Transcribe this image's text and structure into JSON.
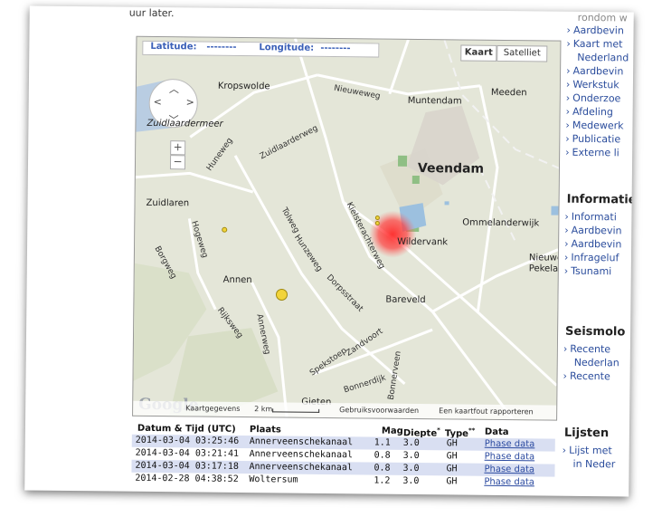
{
  "intro_text": "uur later.",
  "map": {
    "coords": {
      "latitude_label": "Latitude:",
      "latitude_value": "--------",
      "longitude_label": "Longitude:",
      "longitude_value": "--------"
    },
    "map_type_buttons": [
      "Kaart",
      "Satelliet"
    ],
    "zoom_in": "+",
    "zoom_out": "−",
    "places": [
      "Kropswolde",
      "Zuidlaardermeer",
      "Muntendam",
      "Meeden",
      "Veendam",
      "Zuidlaren",
      "Ommelanderwijk",
      "Wildervank",
      "Nieuwe",
      "Pekela",
      "Annen",
      "Bareveld",
      "Gieten"
    ],
    "roads": [
      "Nieuweweg",
      "Zuidlaarderweg",
      "Huneweg",
      "Tolweg",
      "Hunzeweg",
      "Kielsterachterweg",
      "Hogeweg",
      "Borgweg",
      "Dorpsstraat",
      "Rijksweg",
      "Annerweg",
      "Spekstoep",
      "Zandvoort",
      "Bonnerdijk",
      "Bonnerveen"
    ],
    "footer": {
      "logo": "Google",
      "data_link": "Kaartgegevens",
      "scale": "2 km",
      "terms": "Gebruiksvoorwaarden",
      "report": "Een kaartfout rapporteren"
    },
    "markers_color_yellow": "#f2d43a",
    "heat_color": "#ff2a2a"
  },
  "table": {
    "headers": {
      "datetime": "Datum & Tijd (UTC)",
      "place": "Plaats",
      "mag": "Mag",
      "depth": "Diepte",
      "depth_sup": "*",
      "type": "Type",
      "type_sup": "**",
      "data": "Data"
    },
    "rows": [
      {
        "datetime": "2014-03-04 03:25:46",
        "place": "Annerveenschekanaal",
        "mag": "1.1",
        "depth": "3.0",
        "type": "GH",
        "data": "Phase data"
      },
      {
        "datetime": "2014-03-04 03:21:41",
        "place": "Annerveenschekanaal",
        "mag": "0.8",
        "depth": "3.0",
        "type": "GH",
        "data": "Phase data"
      },
      {
        "datetime": "2014-03-04 03:17:18",
        "place": "Annerveenschekanaal",
        "mag": "0.8",
        "depth": "3.0",
        "type": "GH",
        "data": "Phase data"
      },
      {
        "datetime": "2014-02-28 04:38:52",
        "place": "Woltersum",
        "mag": "1.2",
        "depth": "3.0",
        "type": "GH",
        "data": "Phase data"
      }
    ]
  },
  "sidebar": {
    "top_items": [
      "rondom w",
      "Aardbevin",
      "Kaart met",
      "Nederland",
      "Aardbevin",
      "Werkstuk",
      "Onderzoe",
      "Afdeling",
      "Medewerk",
      "Publicatie",
      "Externe li"
    ],
    "section1_title": "Informatie",
    "section1_items": [
      "Informati",
      "Aardbevin",
      "Aardbevin",
      "Infrageluf",
      "Tsunami"
    ],
    "section2_title": "Seismolo",
    "section2_items": [
      "Recente",
      "Nederlan",
      "Recente"
    ],
    "section3_title": "Lijsten",
    "section3_items": [
      "Lijst met",
      "in Neder"
    ]
  }
}
